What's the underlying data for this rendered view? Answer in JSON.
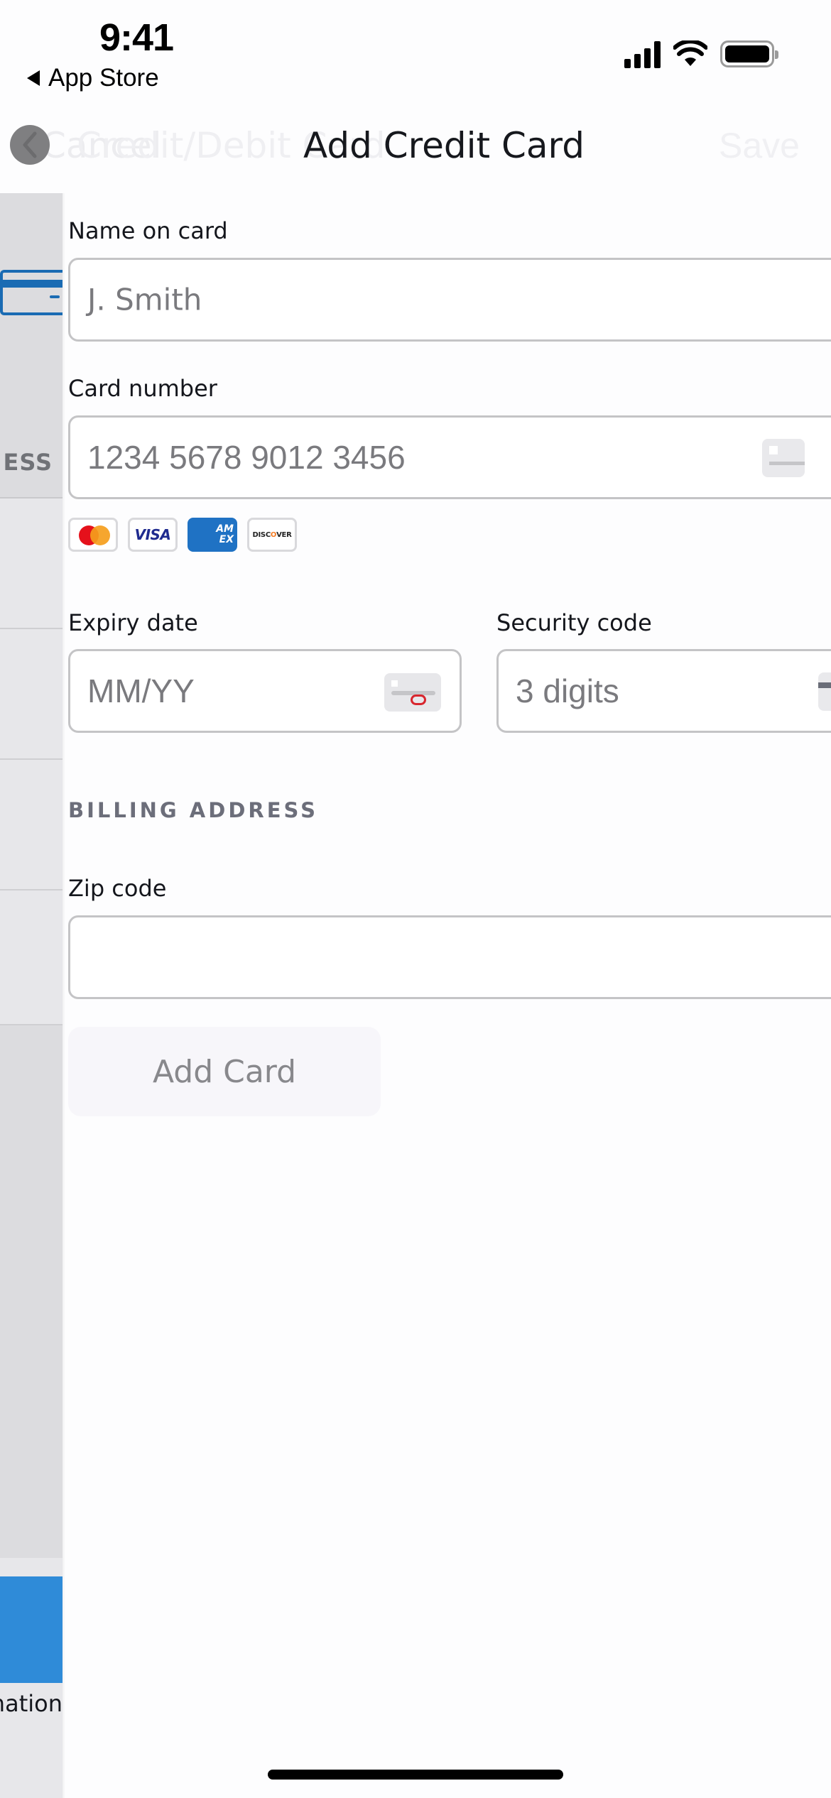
{
  "status_bar": {
    "time": "9:41",
    "back_app": "App Store",
    "icons": [
      "cellular-signal-icon",
      "wifi-icon",
      "battery-icon"
    ]
  },
  "nav": {
    "title": "Add Credit Card",
    "ghost_left_button": "Cancel",
    "ghost_previous_title": "Credit/Debit Card",
    "ghost_right_button": "Save",
    "back_icon": "chevron-left-icon"
  },
  "previous_screen": {
    "section_fragment": "ESS",
    "bottom_text_fragment": "mation",
    "card_icon": "credit-card-icon",
    "accent_color": "#2f8bd8"
  },
  "form": {
    "name": {
      "label": "Name on card",
      "placeholder": "J. Smith",
      "value": ""
    },
    "card_number": {
      "label": "Card number",
      "placeholder": "1234 5678 9012 3456",
      "value": "",
      "accepted_brands": [
        "Mastercard",
        "VISA",
        "AMEX",
        "DISCOVER"
      ]
    },
    "expiry": {
      "label": "Expiry date",
      "placeholder": "MM/YY",
      "value": ""
    },
    "security_code": {
      "label": "Security code",
      "placeholder": "3 digits",
      "value": ""
    },
    "billing_section_title": "BILLING ADDRESS",
    "zip": {
      "label": "Zip code",
      "placeholder": "",
      "value": ""
    },
    "submit_label": "Add Card",
    "submit_enabled": false
  },
  "brand_text": {
    "visa": "VISA",
    "amex_line1": "AM",
    "amex_line2": "EX",
    "discover_pre": "DISC",
    "discover_o": "O",
    "discover_post": "VER"
  }
}
